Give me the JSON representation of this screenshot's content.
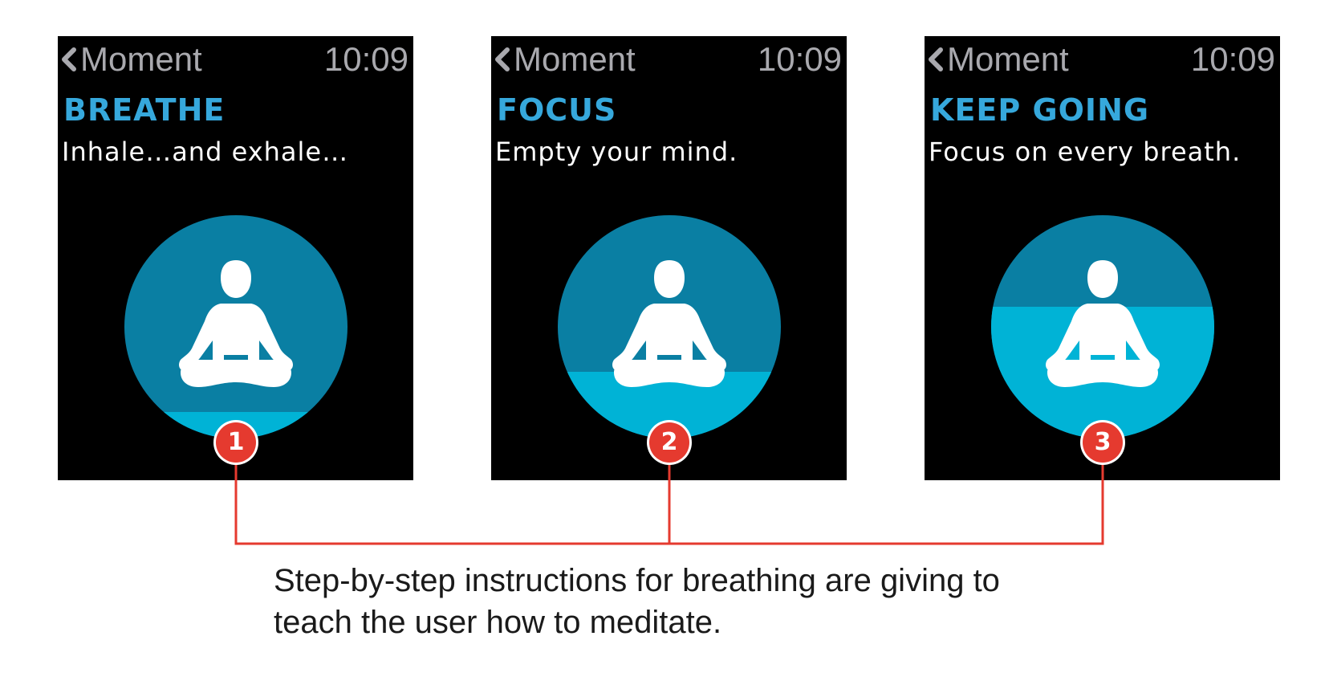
{
  "screens": [
    {
      "back_label": "Moment",
      "time": "10:09",
      "title": "BREATHE",
      "subtitle": "Inhale…and exhale…",
      "fill_level": 0.12,
      "marker": "1"
    },
    {
      "back_label": "Moment",
      "time": "10:09",
      "title": "FOCUS",
      "subtitle": "Empty your mind.",
      "fill_level": 0.3,
      "marker": "2"
    },
    {
      "back_label": "Moment",
      "time": "10:09",
      "title": "KEEP GOING",
      "subtitle": "Focus on every breath.",
      "fill_level": 0.59,
      "marker": "3"
    }
  ],
  "caption": {
    "line1": "Step-by-step instructions for breathing are giving to",
    "line2": "teach the user how to meditate."
  },
  "icons": {
    "back": "chevron-left-icon",
    "figure": "meditation-figure-icon"
  },
  "colors": {
    "screen_bg": "#000000",
    "status_text": "#a9a9ae",
    "title": "#36a8dc",
    "orb_dark": "#0a7fa3",
    "orb_light": "#00b3d6",
    "marker": "#e53a2f",
    "connector": "#e53a2f",
    "caption_text": "#1a1a1a"
  }
}
